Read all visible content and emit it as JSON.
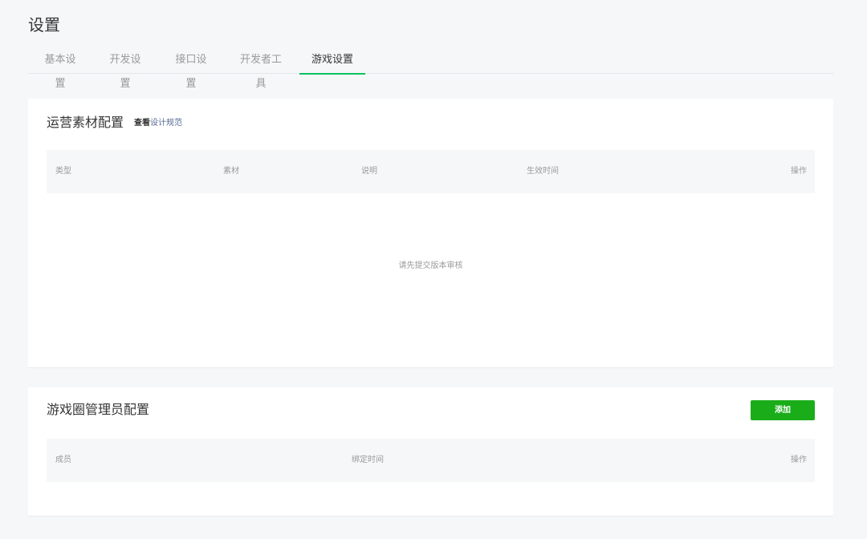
{
  "page": {
    "title": "设置"
  },
  "tabs": [
    {
      "label": "基本设置"
    },
    {
      "label": "开发设置"
    },
    {
      "label": "接口设置"
    },
    {
      "label": "开发者工具"
    },
    {
      "label": "游戏设置"
    }
  ],
  "active_tab": "游戏设置",
  "materials": {
    "title": "运营素材配置",
    "design_link_prefix": "查看",
    "design_link_text": "设计规范",
    "columns": [
      "类型",
      "素材",
      "说明",
      "生效时间",
      "操作"
    ],
    "empty_text": "请先提交版本审核"
  },
  "admins": {
    "title": "游戏圈管理员配置",
    "add_button": "添加",
    "columns": [
      "成员",
      "绑定时间",
      "操作"
    ]
  },
  "colors": {
    "accent": "#07c160",
    "button": "#1aad19",
    "link": "#576b95",
    "background": "#f6f7f9"
  }
}
